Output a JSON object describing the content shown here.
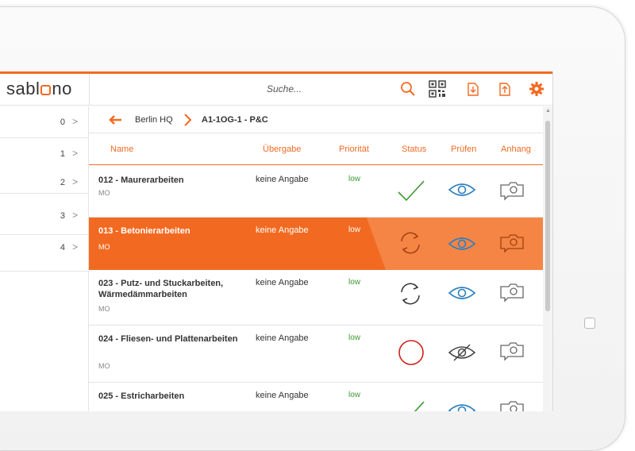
{
  "header": {
    "logo_text_before": "sabl",
    "logo_text_after": "no",
    "search_placeholder": "Suche..."
  },
  "colors": {
    "accent": "#f26a21",
    "check": "#3a9a2e",
    "eye": "#2b7fc1",
    "error": "#d0201a"
  },
  "left_panel": {
    "rows": [
      {
        "number": "0"
      },
      {
        "number": "1"
      },
      {
        "number": "2"
      },
      {
        "number": "3"
      },
      {
        "number": "4"
      }
    ]
  },
  "breadcrumb": {
    "parent": "Berlin HQ",
    "current": "A1-1OG-1 - P&C"
  },
  "columns": {
    "name": "Name",
    "uebergabe": "Übergabe",
    "prioritaet": "Priorität",
    "status": "Status",
    "pruefen": "Prüfen",
    "anhang": "Anhang"
  },
  "rows": [
    {
      "title": "012 - Maurerarbeiten",
      "sub": "MO",
      "uebergabe": "keine Angabe",
      "prioritaet": "low",
      "status": "check-icon",
      "pruefen": "eye-icon"
    },
    {
      "title": "013 - Betonierarbeiten",
      "sub": "MO",
      "uebergabe": "keine Angabe",
      "prioritaet": "low",
      "status": "sync-icon",
      "pruefen": "eye-icon"
    },
    {
      "title": "023 - Putz- und Stuckarbeiten, Wärmedämmarbeiten",
      "sub": "MO",
      "uebergabe": "keine Angabe",
      "prioritaet": "low",
      "status": "sync-icon",
      "pruefen": "eye-icon"
    },
    {
      "title": "024 - Fliesen- und Plattenarbeiten",
      "sub": "MO",
      "uebergabe": "keine Angabe",
      "prioritaet": "low",
      "status": "circle-icon",
      "pruefen": "eye-crossed-icon"
    },
    {
      "title": "025 - Estricharbeiten",
      "sub": "",
      "uebergabe": "keine Angabe",
      "prioritaet": "low",
      "status": "check-icon",
      "pruefen": "eye-icon"
    }
  ]
}
